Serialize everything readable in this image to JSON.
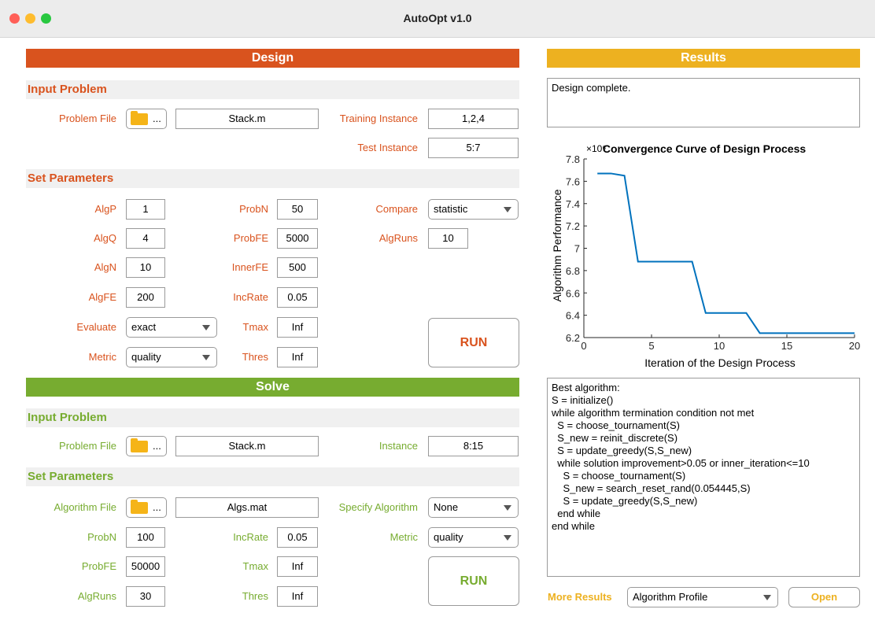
{
  "window": {
    "title": "AutoOpt v1.0"
  },
  "colors": {
    "design": "#d9531e",
    "solve": "#77ac30",
    "results": "#edb120",
    "plot_line": "#0072bd"
  },
  "design": {
    "header": "Design",
    "input_problem": {
      "title": "Input Problem",
      "problem_file_label": "Problem File",
      "file_button_text": "...",
      "problem_file_value": "Stack.m",
      "training_label": "Training Instance",
      "training_value": "1,2,4",
      "test_label": "Test Instance",
      "test_value": "5:7"
    },
    "set_parameters": {
      "title": "Set Parameters",
      "algp_label": "AlgP",
      "algp_value": "1",
      "algq_label": "AlgQ",
      "algq_value": "4",
      "algn_label": "AlgN",
      "algn_value": "10",
      "algfe_label": "AlgFE",
      "algfe_value": "200",
      "evaluate_label": "Evaluate",
      "evaluate_value": "exact",
      "metric_label": "Metric",
      "metric_value": "quality",
      "probn_label": "ProbN",
      "probn_value": "50",
      "probfe_label": "ProbFE",
      "probfe_value": "5000",
      "innerfe_label": "InnerFE",
      "innerfe_value": "500",
      "incrate_label": "IncRate",
      "incrate_value": "0.05",
      "tmax_label": "Tmax",
      "tmax_value": "Inf",
      "thres_label": "Thres",
      "thres_value": "Inf",
      "compare_label": "Compare",
      "compare_value": "statistic",
      "algruns_label": "AlgRuns",
      "algruns_value": "10"
    },
    "run_label": "RUN"
  },
  "solve": {
    "header": "Solve",
    "input_problem": {
      "title": "Input Problem",
      "problem_file_label": "Problem File",
      "file_button_text": "...",
      "problem_file_value": "Stack.m",
      "instance_label": "Instance",
      "instance_value": "8:15"
    },
    "set_parameters": {
      "title": "Set Parameters",
      "algorithm_file_label": "Algorithm File",
      "file_button_text": "...",
      "algorithm_file_value": "Algs.mat",
      "specify_label": "Specify Algorithm",
      "specify_value": "None",
      "probn_label": "ProbN",
      "probn_value": "100",
      "probfe_label": "ProbFE",
      "probfe_value": "50000",
      "algruns_label": "AlgRuns",
      "algruns_value": "30",
      "incrate_label": "IncRate",
      "incrate_value": "0.05",
      "tmax_label": "Tmax",
      "tmax_value": "Inf",
      "thres_label": "Thres",
      "thres_value": "Inf",
      "metric_label": "Metric",
      "metric_value": "quality"
    },
    "run_label": "RUN"
  },
  "results": {
    "header": "Results",
    "status_text": "Design complete.",
    "algorithm_text": "Best algorithm:\nS = initialize()\nwhile algorithm termination condition not met\n  S = choose_tournament(S)\n  S_new = reinit_discrete(S)\n  S = update_greedy(S,S_new)\n  while solution improvement>0.05 or inner_iteration<=10\n    S = choose_tournament(S)\n    S_new = search_reset_rand(0.054445,S)\n    S = update_greedy(S,S_new)\n  end while\nend while",
    "more_label": "More Results",
    "more_value": "Algorithm Profile",
    "open_label": "Open"
  },
  "chart_data": {
    "type": "line",
    "title": "Convergence Curve of Design Process",
    "xlabel": "Iteration of the Design Process",
    "ylabel": "Algorithm Performance",
    "y_exponent_label": "×10⁶",
    "xlim": [
      0,
      20
    ],
    "ylim": [
      6.2,
      7.8
    ],
    "x_ticks": [
      "0",
      "5",
      "10",
      "15",
      "20"
    ],
    "y_ticks": [
      "6.2",
      "6.4",
      "6.6",
      "6.8",
      "7",
      "7.2",
      "7.4",
      "7.6",
      "7.8"
    ],
    "grid": false,
    "series": [
      {
        "x": [
          1,
          2,
          3,
          4,
          5,
          6,
          7,
          8,
          9,
          10,
          11,
          12,
          13,
          14,
          15,
          16,
          17,
          18,
          19,
          20
        ],
        "values": [
          7.67,
          7.67,
          7.65,
          6.88,
          6.88,
          6.88,
          6.88,
          6.88,
          6.42,
          6.42,
          6.42,
          6.42,
          6.24,
          6.24,
          6.24,
          6.24,
          6.24,
          6.24,
          6.24,
          6.24
        ]
      }
    ]
  }
}
